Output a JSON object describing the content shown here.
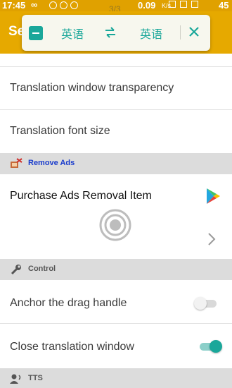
{
  "status_bar": {
    "time": "17:45",
    "infinity": "∞",
    "page_indicator": "3/3",
    "speed": "0.09",
    "speed_unit": "K/s",
    "battery": "45"
  },
  "app_bar": {
    "title": "Se"
  },
  "translate_popup": {
    "source_lang": "英语",
    "target_lang": "英语"
  },
  "settings": {
    "window_transparency": "Translation window transparency",
    "font_size": "Translation font size",
    "remove_ads_section": "Remove Ads",
    "purchase_item": "Purchase Ads Removal Item",
    "control_section": "Control",
    "anchor_drag": "Anchor the drag handle",
    "close_window": "Close translation window",
    "tts_section": "TTS"
  },
  "toggles": {
    "anchor_drag_on": false,
    "close_window_on": true
  },
  "colors": {
    "accent": "#e6a900",
    "teal": "#1aa79a",
    "ads_link": "#1a3ccc"
  }
}
